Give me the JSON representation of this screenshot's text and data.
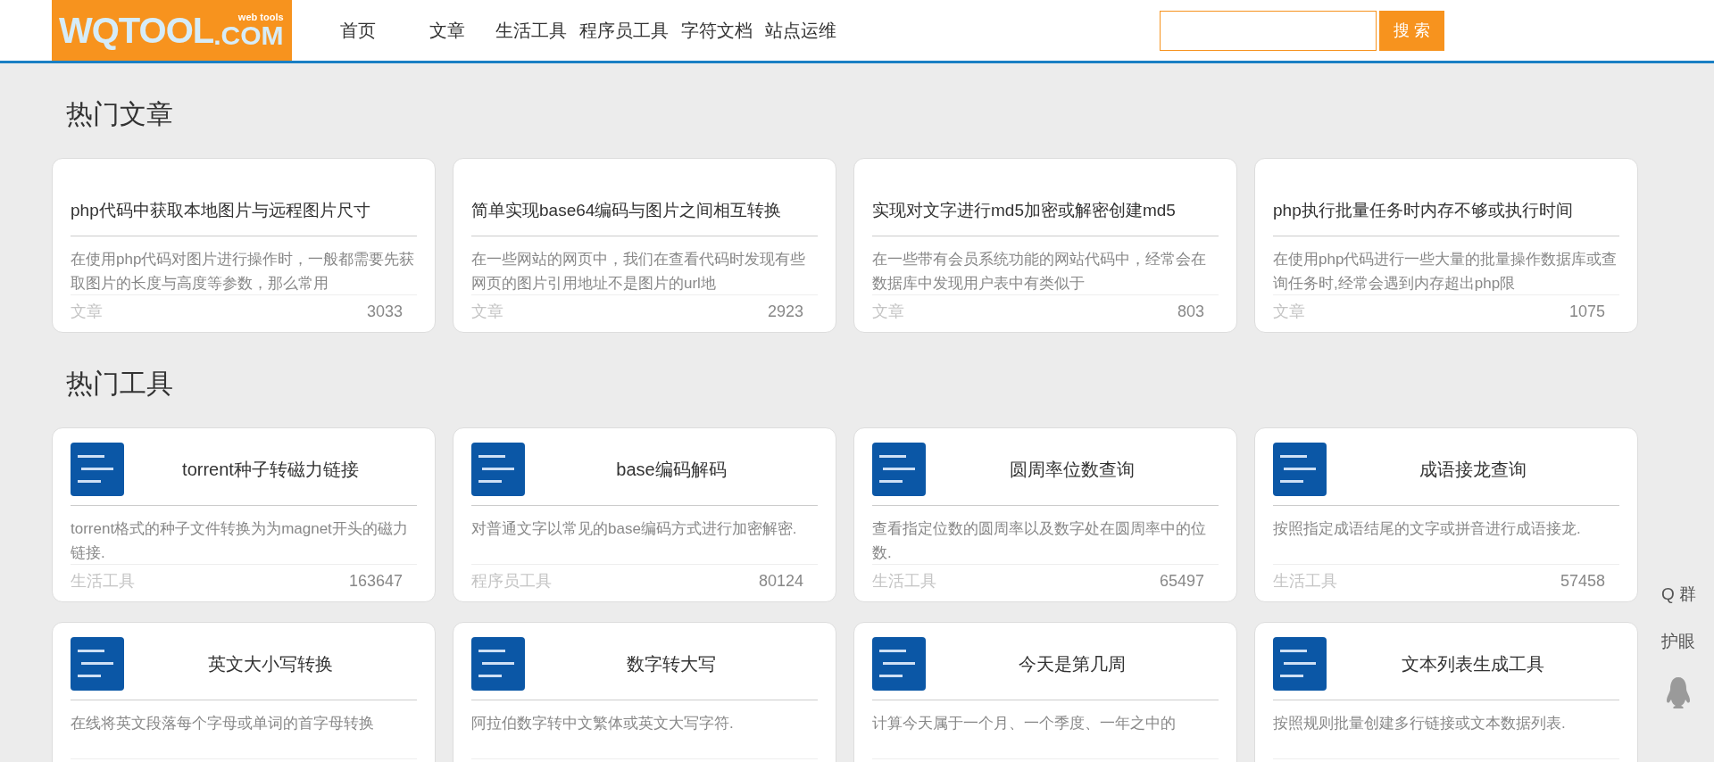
{
  "logo": {
    "text": "WQTOOL",
    "suffix": ".COM",
    "tagline": "web tools"
  },
  "nav": [
    {
      "label": "首页"
    },
    {
      "label": "文章"
    },
    {
      "label": "生活工具"
    },
    {
      "label": "程序员工具"
    },
    {
      "label": "字符文档"
    },
    {
      "label": "站点运维"
    }
  ],
  "search": {
    "button": "搜 索"
  },
  "sections": [
    {
      "title": "热门文章",
      "kind": "article",
      "cards": [
        {
          "title": "php代码中获取本地图片与远程图片尺寸",
          "description": "在使用php代码对图片进行操作时，一般都需要先获取图片的长度与高度等参数，那么常用",
          "category": "文章",
          "count": "3033"
        },
        {
          "title": "简单实现base64编码与图片之间相互转换",
          "description": "在一些网站的网页中，我们在查看代码时发现有些网页的图片引用地址不是图片的url地",
          "category": "文章",
          "count": "2923"
        },
        {
          "title": "实现对文字进行md5加密或解密创建md5",
          "description": "在一些带有会员系统功能的网站代码中，经常会在数据库中发现用户表中有类似于",
          "category": "文章",
          "count": "803"
        },
        {
          "title": "php执行批量任务时内存不够或执行时间",
          "description": "在使用php代码进行一些大量的批量操作数据库或查询任务时,经常会遇到内存超出php限",
          "category": "文章",
          "count": "1075"
        }
      ]
    },
    {
      "title": "热门工具",
      "kind": "tool",
      "cards": [
        {
          "title": "torrent种子转磁力链接",
          "description": "torrent格式的种子文件转换为为magnet开头的磁力链接.",
          "category": "生活工具",
          "count": "163647"
        },
        {
          "title": "base编码解码",
          "description": "对普通文字以常见的base编码方式进行加密解密.",
          "category": "程序员工具",
          "count": "80124"
        },
        {
          "title": "圆周率位数查询",
          "description": "查看指定位数的圆周率以及数字处在圆周率中的位数.",
          "category": "生活工具",
          "count": "65497"
        },
        {
          "title": "成语接龙查询",
          "description": "按照指定成语结尾的文字或拼音进行成语接龙.",
          "category": "生活工具",
          "count": "57458"
        },
        {
          "title": "英文大小写转换",
          "description": "在线将英文段落每个字母或单词的首字母转换"
        },
        {
          "title": "数字转大写",
          "description": "阿拉伯数字转中文繁体或英文大写字符."
        },
        {
          "title": "今天是第几周",
          "description": "计算今天属于一个月、一个季度、一年之中的"
        },
        {
          "title": "文本列表生成工具",
          "description": "按照规则批量创建多行链接或文本数据列表."
        }
      ]
    }
  ],
  "side": [
    {
      "label": "Q 群"
    },
    {
      "label": "护眼"
    }
  ]
}
